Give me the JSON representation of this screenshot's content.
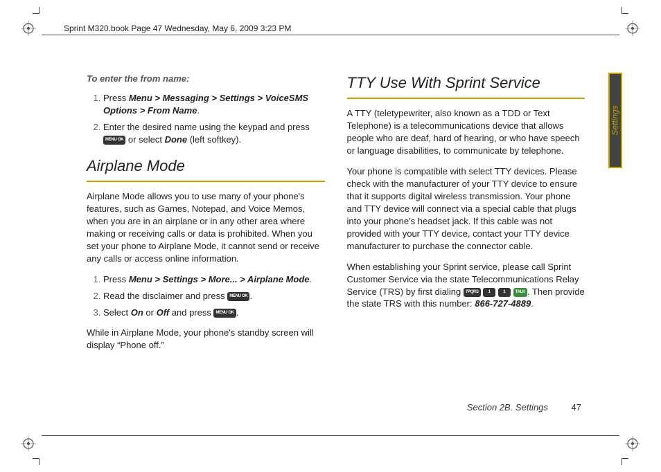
{
  "header": "Sprint M320.book  Page 47  Wednesday, May 6, 2009  3:23 PM",
  "sideTab": "Settings",
  "col1": {
    "leadin": "To enter the from name:",
    "step1_pre": "Press ",
    "step1_path": "Menu > Messaging > Settings > VoiceSMS Options > From Name",
    "step1_post": ".",
    "step2_pre": "Enter the desired name using the keypad and press ",
    "step2_mid": " or select ",
    "step2_done": "Done",
    "step2_post": " (left softkey).",
    "heading": "Airplane Mode",
    "body1": "Airplane Mode allows you to use many of your phone's features, such as Games, Notepad, and Voice Memos, when you are in an airplane or in any other area where making or receiving calls or data is prohibited. When you set your phone to Airplane Mode, it cannot send or receive any calls or access online information.",
    "am_step1_pre": "Press ",
    "am_step1_path": "Menu > Settings > More... > Airplane Mode",
    "am_step1_post": ".",
    "am_step2_pre": "Read the disclaimer and press ",
    "am_step2_post": ".",
    "am_step3_pre": "Select ",
    "am_step3_on": "On",
    "am_step3_or": " or ",
    "am_step3_off": "Off",
    "am_step3_and": " and press ",
    "am_step3_post": ".",
    "body2": "While in Airplane Mode, your phone's standby screen will display “Phone off.”"
  },
  "col2": {
    "heading": "TTY Use With Sprint Service",
    "p1": "A TTY (teletypewriter, also known as a TDD or Text Telephone) is a telecommunications device that allows people who are deaf, hard of hearing, or who have speech or language disabilities, to communicate by telephone.",
    "p2": "Your phone is compatible with select TTY devices. Please check with the manufacturer of your TTY device to ensure that it supports digital wireless transmission. Your phone and TTY device will connect via a special cable that plugs into your phone's headset jack. If this cable was not provided with your TTY device, contact your TTY device manufacturer to purchase the connector cable.",
    "p3_pre": "When establishing your Sprint service, please call Sprint Customer Service via the state Telecommunications Relay Service (TRS) by first dialing ",
    "p3_mid": ". Then provide the state TRS with this number: ",
    "p3_num": "866-727-4889",
    "p3_post": "."
  },
  "keys": {
    "menu": "MENU\nOK",
    "seven": "7PQRS",
    "one": "1",
    "talk": "TALK"
  },
  "footer": {
    "section": "Section 2B. Settings",
    "page": "47"
  }
}
